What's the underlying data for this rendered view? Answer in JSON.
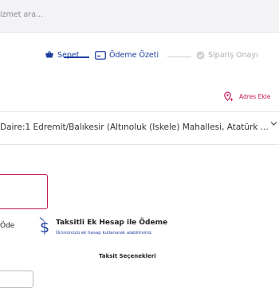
{
  "search": {
    "placeholder_visible": "izmet ara..."
  },
  "stepper": {
    "cart_label": "Sepet",
    "summary_label": "Ödeme Özeti",
    "approval_label": "Sipariş Onayı"
  },
  "address": {
    "add_label": "Adres Ekle",
    "selected_text": "Daire:1 Edremit/Balıkesir (Altınoluk (İskele) Mahallesi, Atatürk ..."
  },
  "payment": {
    "pay_label": "Öde",
    "installment_title": "Taksitli Ek Hesap ile Ödeme",
    "installment_subtitle": "Ürününüzü ek hesap kullanarak alabilirsiniz.",
    "installment_options_label": "Taksit Seçenekleri"
  },
  "colors": {
    "primary_blue": "#1e3fa0",
    "accent_pink": "#c2185b",
    "muted_gray": "#b0b0b4"
  },
  "icons": {
    "cart": "cart-icon",
    "summary": "card-icon",
    "approval": "check-circle-icon",
    "location": "location-plus-icon",
    "chevron": "chevron-down-icon",
    "installment": "dollar-installment-icon"
  }
}
